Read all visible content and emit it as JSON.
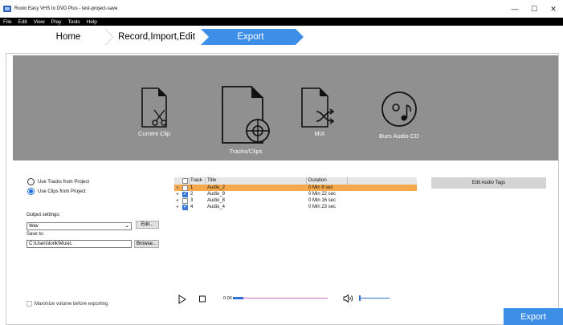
{
  "window": {
    "title": "Roxio Easy VHS to DVD Plus - test-project-save",
    "minimize": "—",
    "maximize": "☐",
    "close": "✕"
  },
  "menu": [
    "File",
    "Edit",
    "View",
    "Play",
    "Tools",
    "Help"
  ],
  "breadcrumb": {
    "steps": [
      "Home",
      "Record,Import,Edit",
      "Export"
    ],
    "active": "Export",
    "active_color": "#3d8ee6"
  },
  "hero": {
    "items": [
      {
        "label": "Current Clip",
        "icon": "scissors-file-icon"
      },
      {
        "label": "Tracks/Clips",
        "icon": "tracks-file-icon"
      },
      {
        "label": "MIX",
        "icon": "shuffle-file-icon"
      },
      {
        "label": "Burn Audio CD",
        "icon": "music-disc-icon"
      }
    ]
  },
  "source": {
    "options": [
      "Use Tracks from Project",
      "Use Clips from Project"
    ],
    "selected": "Use Clips from Project"
  },
  "output": {
    "settings_label": "Output settings:",
    "format": "Wav",
    "edit_button": "Edit...",
    "save_to_label": "Save to:",
    "path": "C:\\Users\\lorik\\Music",
    "browse_button": "Browse..."
  },
  "table": {
    "columns": [
      "Track",
      "Title",
      "Duration"
    ],
    "rows": [
      {
        "track": "1",
        "title": "Audio_2",
        "duration": "0 Min 9 sec",
        "checked": false,
        "selected": true
      },
      {
        "track": "2",
        "title": "Audio_9",
        "duration": "0 Min 22 sec",
        "checked": true,
        "selected": false
      },
      {
        "track": "3",
        "title": "Audio_8",
        "duration": "0 Min 16 sec",
        "checked": false,
        "selected": false
      },
      {
        "track": "4",
        "title": "Audio_4",
        "duration": "0 Min 23 sec",
        "checked": true,
        "selected": false
      }
    ]
  },
  "edit_audio_tags": "Edit Audio Tags",
  "player": {
    "time": "0:00",
    "seek_progress": 0.11,
    "volume": 1.0
  },
  "maximize_volume_label": "Maximize volume before exporting",
  "export_button": "Export"
}
